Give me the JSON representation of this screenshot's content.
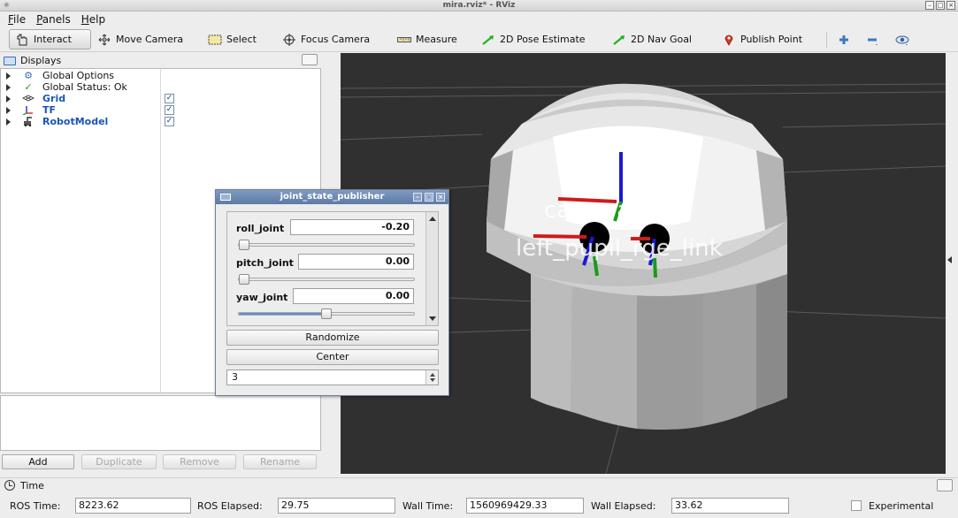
{
  "window": {
    "title": "mira.rviz* - RViz"
  },
  "menu": [
    {
      "label": "File",
      "accel": "F",
      "rest": "ile"
    },
    {
      "label": "Panels",
      "accel": "P",
      "rest": "anels"
    },
    {
      "label": "Help",
      "accel": "H",
      "rest": "elp"
    }
  ],
  "toolbar": {
    "interact": "Interact",
    "move_camera": "Move Camera",
    "select": "Select",
    "focus_camera": "Focus Camera",
    "measure": "Measure",
    "pose_estimate": "2D Pose Estimate",
    "nav_goal": "2D Nav Goal",
    "publish_point": "Publish Point",
    "active_tool": "Interact"
  },
  "displays": {
    "title": "Displays",
    "items": [
      {
        "label": "Global Options",
        "icon": "gear-icon",
        "checked": null
      },
      {
        "label": "Global Status: Ok",
        "icon": "checkmark-icon",
        "checked": null
      },
      {
        "label": "Grid",
        "icon": "grid-icon",
        "checked": true
      },
      {
        "label": "TF",
        "icon": "axes-icon",
        "checked": true
      },
      {
        "label": "RobotModel",
        "icon": "robot-icon",
        "checked": true
      }
    ],
    "buttons": {
      "add": "Add",
      "duplicate": "Duplicate",
      "remove": "Remove",
      "rename": "Rename"
    }
  },
  "view3d": {
    "frame_labels": [
      "camera_link",
      "left_pupil_rge_link"
    ]
  },
  "joint_state_publisher": {
    "title": "joint_state_publisher",
    "joints": [
      {
        "name": "roll_joint",
        "value": "-0.20",
        "slider_fraction": 0.03
      },
      {
        "name": "pitch_joint",
        "value": "0.00",
        "slider_fraction": 0.03
      },
      {
        "name": "yaw_joint",
        "value": "0.00",
        "slider_fraction": 0.5
      }
    ],
    "randomize": "Randomize",
    "center": "Center",
    "spin_value": "3"
  },
  "time": {
    "title": "Time",
    "ros_time_label": "ROS Time:",
    "ros_time": "8223.62",
    "ros_elapsed_label": "ROS Elapsed:",
    "ros_elapsed": "29.75",
    "wall_time_label": "Wall Time:",
    "wall_time": "1560969429.33",
    "wall_elapsed_label": "Wall Elapsed:",
    "wall_elapsed": "33.62",
    "experimental": "Experimental"
  }
}
